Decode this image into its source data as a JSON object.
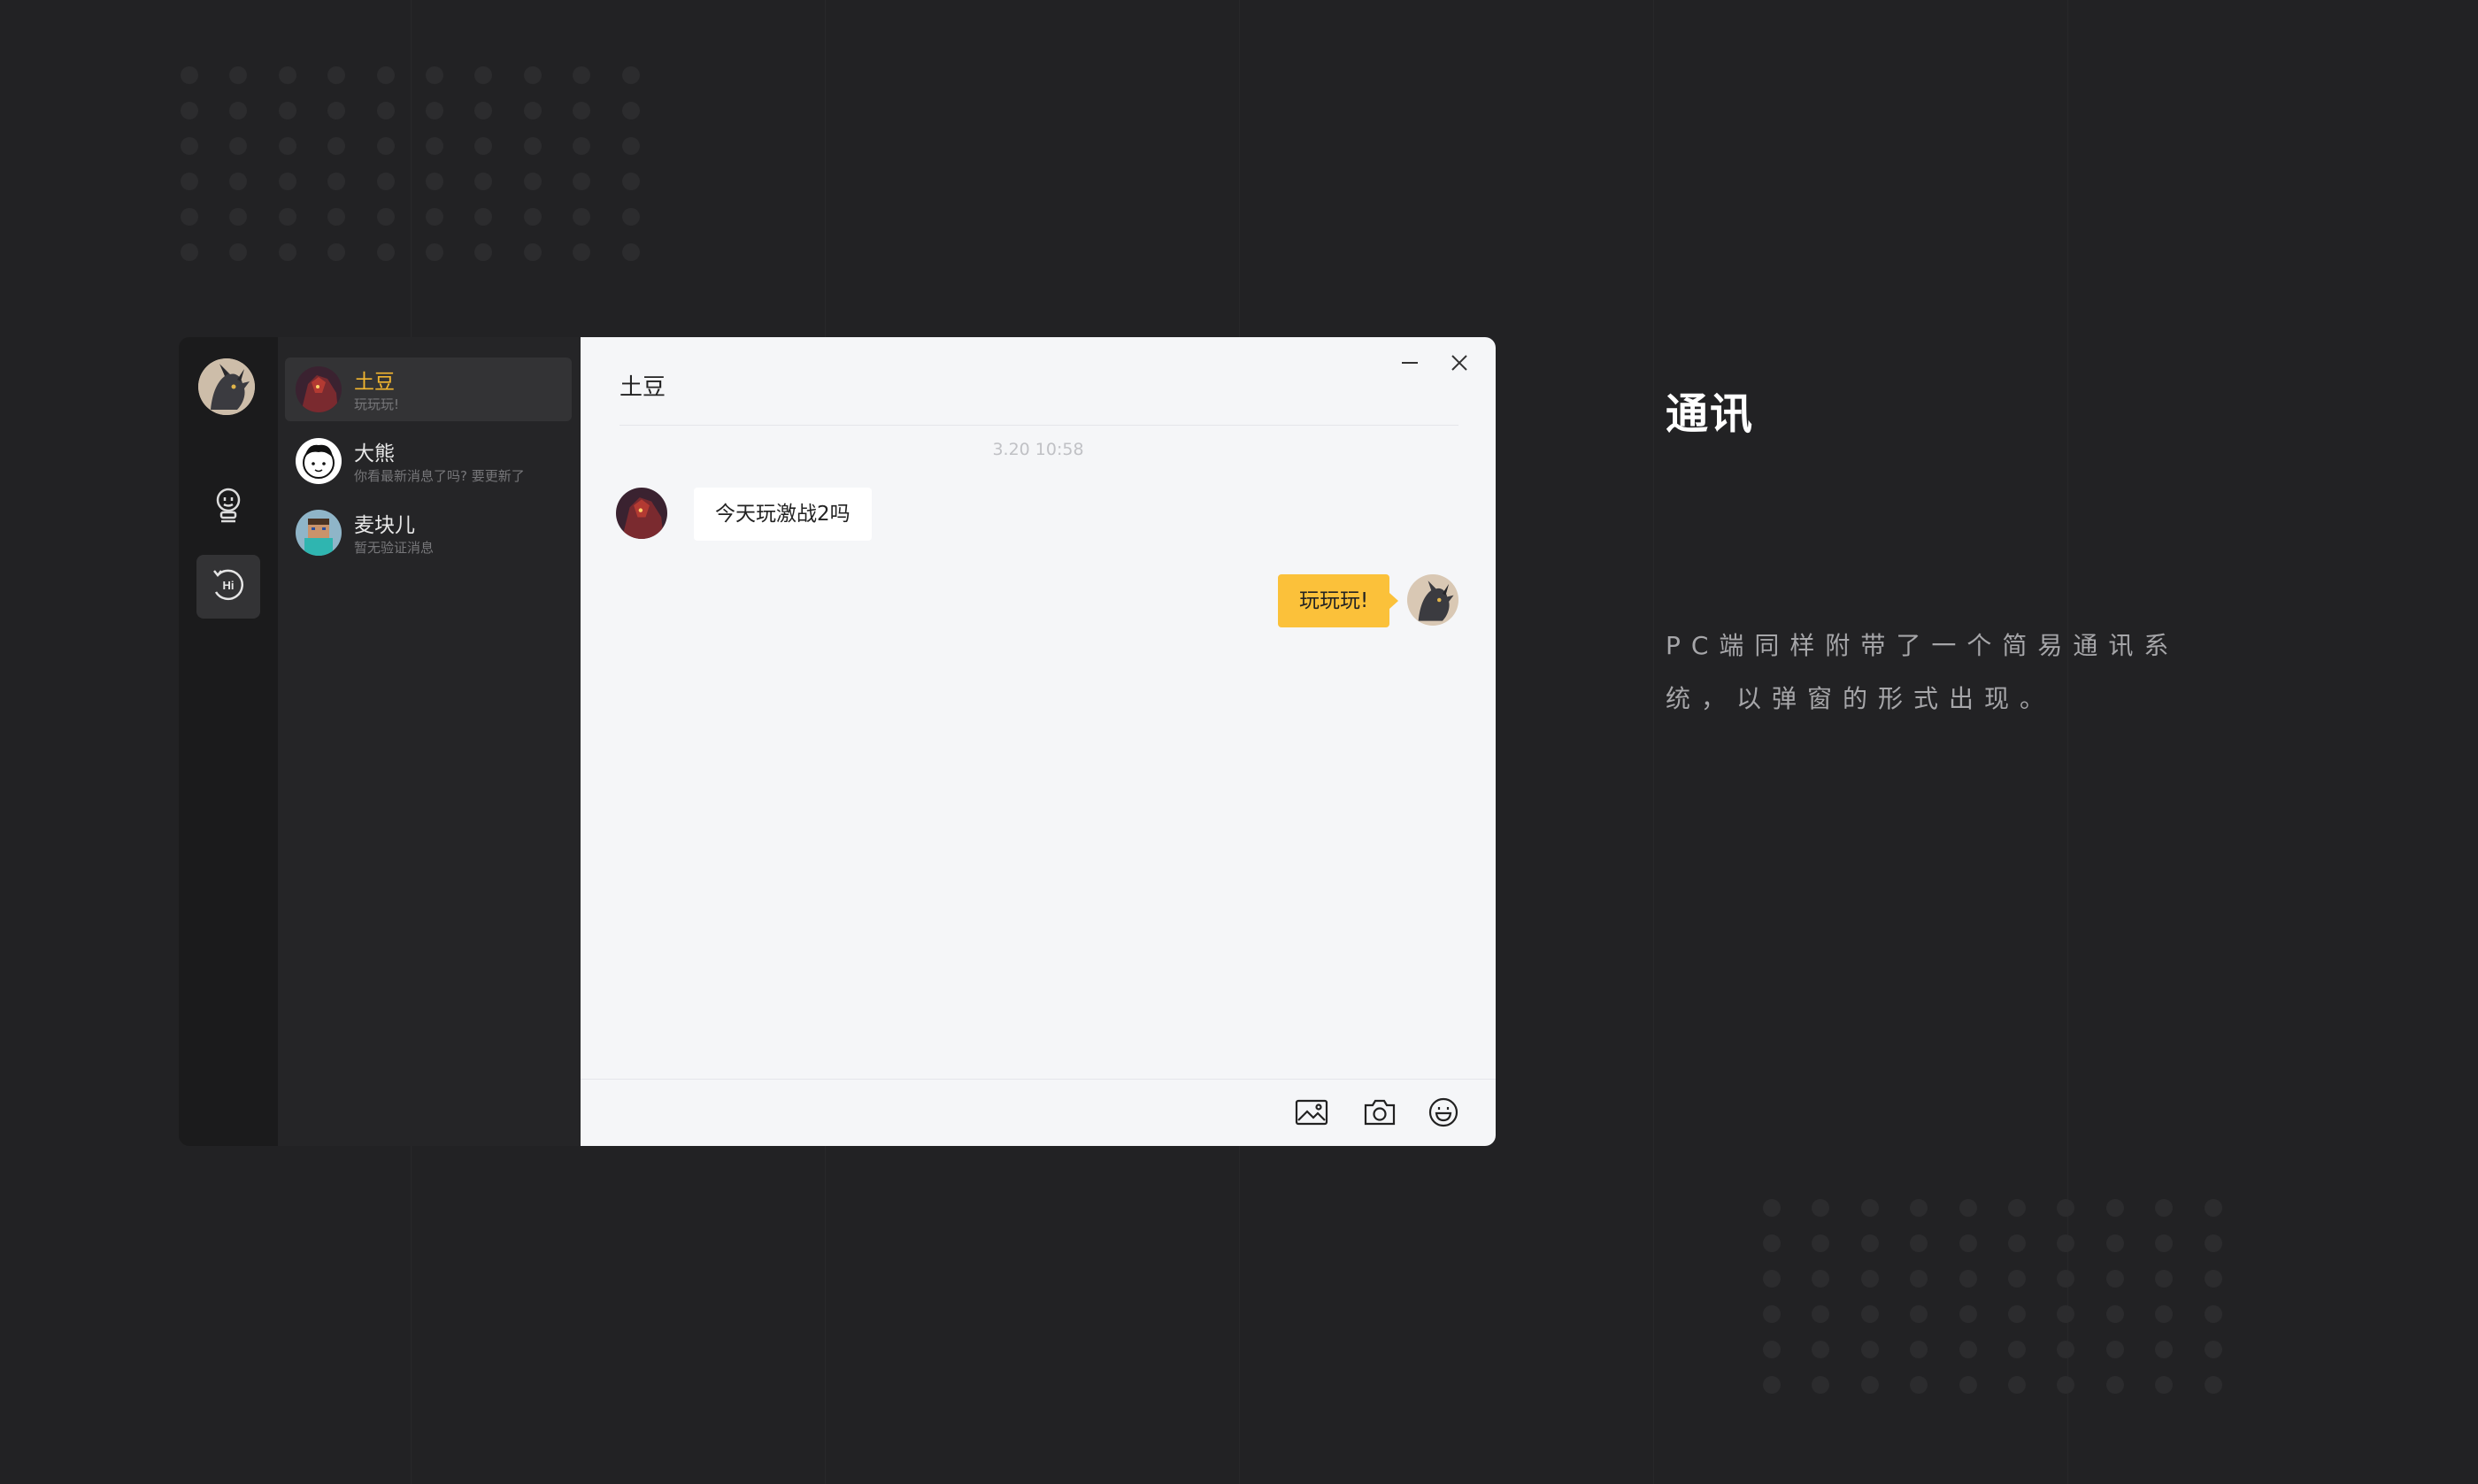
{
  "page": {
    "heading": "通讯",
    "description": "PC端同样附带了一个简易通讯系统，以弹窗的形式出现。"
  },
  "sidebar": {
    "user_avatar_icon": "dragon-avatar-icon",
    "nav": [
      {
        "icon": "robot-icon"
      },
      {
        "icon": "hi-chat-icon",
        "selected": true
      }
    ]
  },
  "contacts": [
    {
      "name": "土豆",
      "preview": "玩玩玩!",
      "avatar": "warrior-avatar-icon",
      "active": true
    },
    {
      "name": "大熊",
      "preview": "你看最新消息了吗? 要更新了",
      "avatar": "bear-avatar-icon",
      "active": false
    },
    {
      "name": "麦块儿",
      "preview": "暂无验证消息",
      "avatar": "blocky-avatar-icon",
      "active": false
    }
  ],
  "chat": {
    "title": "土豆",
    "timestamp": "3.20 10:58",
    "messages": [
      {
        "direction": "incoming",
        "text": "今天玩激战2吗"
      },
      {
        "direction": "outgoing",
        "text": "玩玩玩!"
      }
    ],
    "toolbar": [
      "image-icon",
      "camera-icon",
      "emoji-icon"
    ]
  },
  "colors": {
    "accent": "#fbc13a",
    "active_contact_name": "#f2b630",
    "background": "#222224",
    "chat_background": "#f5f6f8"
  }
}
